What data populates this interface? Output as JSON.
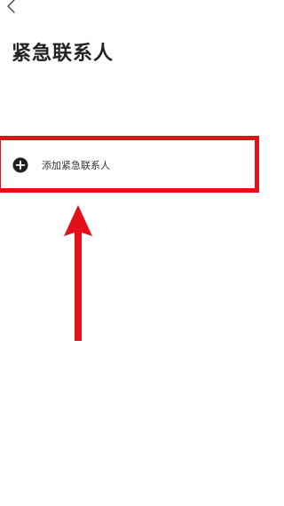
{
  "header": {
    "back_icon": "chevron-left-icon",
    "title": "紧急联系人"
  },
  "contacts": {
    "add_label": "添加紧急联系人",
    "add_icon": "plus-circle-icon"
  },
  "annotation": {
    "highlight_color": "#e3101a",
    "arrow_color": "#e3101a",
    "arrow_direction": "up"
  },
  "colors": {
    "background": "#ffffff",
    "title_text": "#222222",
    "icon_fill": "#1f1f24",
    "label_text": "#333333"
  }
}
